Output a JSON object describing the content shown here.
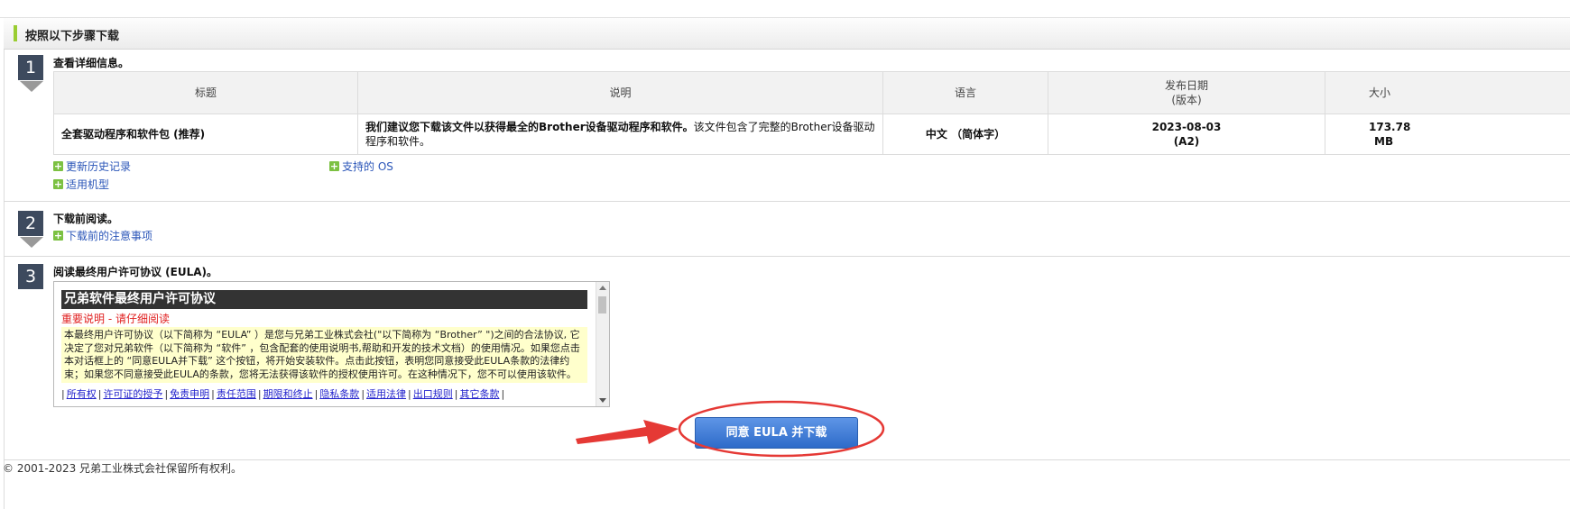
{
  "header": {
    "title": "按照以下步骤下载"
  },
  "steps": [
    {
      "num": "1",
      "title": "查看详细信息。"
    },
    {
      "num": "2",
      "title": "下载前阅读。"
    },
    {
      "num": "3",
      "title": "阅读最终用户许可协议 (EULA)。"
    }
  ],
  "table": {
    "headers": {
      "title": "标题",
      "desc": "说明",
      "lang": "语言",
      "date": "发布日期",
      "version_label": "(版本)",
      "size": "大小"
    },
    "row": {
      "title": "全套驱动程序和软件包 (推荐)",
      "desc_bold": "我们建议您下载该文件以获得最全的Brother设备驱动程序和软件。",
      "desc_normal": "该文件包含了完整的Brother设备驱动程序和软件。",
      "lang": "中文 （简体字）",
      "date": "2023-08-03",
      "version": "(A2)",
      "size_value": "173.78",
      "size_unit": "MB"
    }
  },
  "links": {
    "history": "更新历史记录",
    "os": "支持的 OS",
    "models": "适用机型",
    "notes": "下载前的注意事项"
  },
  "eula": {
    "heading": "兄弟软件最终用户许可协议",
    "warning": "重要说明 - 请仔细阅读",
    "body": "本最终用户许可协议（以下简称为 “EULA” ）是您与兄弟工业株式会社(\"以下简称为 “Brother” \")之间的合法协议, 它决定了您对兄弟软件（以下简称为 “软件” ，包含配套的使用说明书,帮助和开发的技术文档）的使用情况。如果您点击本对话框上的 “同意EULA并下载” 这个按钮，将开始安装软件。点击此按钮，表明您同意接受此EULA条款的法律约束；如果您不同意接受此EULA的条款，您将无法获得该软件的授权使用许可。在这种情况下，您不可以使用该软件。",
    "nav": [
      "所有权",
      "许可证的授予",
      "免责申明",
      "责任范围",
      "期限和终止",
      "隐私条款",
      "适用法律",
      "出口规则",
      "其它条款"
    ]
  },
  "button": {
    "agree": "同意 EULA 并下载"
  },
  "footer": {
    "copyright": "© 2001-2023 兄弟工业株式会社保留所有权利。"
  },
  "colors": {
    "accent_green": "#9acd32",
    "step_badge": "#3d4a5e",
    "button_blue": "#2e6bc9",
    "annotation_red": "#e53935"
  }
}
